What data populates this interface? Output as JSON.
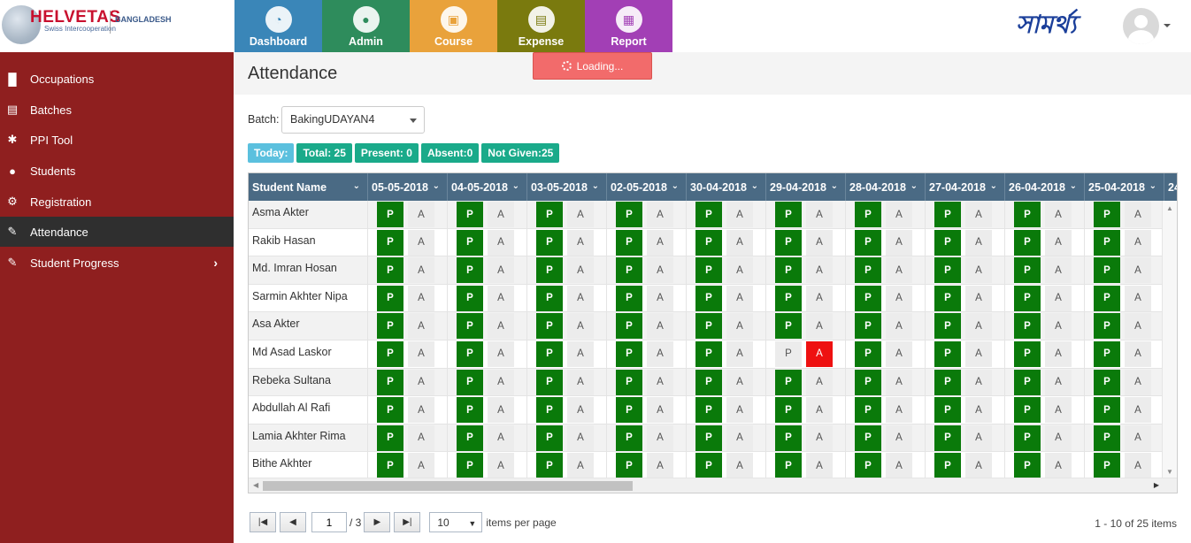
{
  "logo": {
    "brand": "HELVETAS",
    "sub": "Swiss Intercooperation",
    "country": "BANGLADESH"
  },
  "brand_bangla": "সামর্থ্য",
  "menu": [
    {
      "label": "Dashboard",
      "icon": "dashboard-icon",
      "color": "#3a86b8"
    },
    {
      "label": "Admin",
      "icon": "user-icon",
      "color": "#2e8c5c"
    },
    {
      "label": "Course",
      "icon": "book-icon",
      "color": "#e9a23b"
    },
    {
      "label": "Expense",
      "icon": "money-icon",
      "color": "#7a7a0e"
    },
    {
      "label": "Report",
      "icon": "chart-icon",
      "color": "#a23fb5"
    }
  ],
  "loading_text": "Loading...",
  "sidebar": [
    {
      "label": "Occupations",
      "icon": "factory-icon"
    },
    {
      "label": "Batches",
      "icon": "book-icon"
    },
    {
      "label": "PPI Tool",
      "icon": "wrench-icon"
    },
    {
      "label": "Students",
      "icon": "users-icon"
    },
    {
      "label": "Registration",
      "icon": "gears-icon"
    },
    {
      "label": "Attendance",
      "icon": "pencil-icon",
      "active": true
    },
    {
      "label": "Student Progress",
      "icon": "pencil-icon",
      "has_submenu": true
    }
  ],
  "page_title": "Attendance",
  "batch": {
    "label": "Batch:",
    "value": "BakingUDAYAN4"
  },
  "badges": {
    "today": "Today:",
    "total": "Total: 25",
    "present": "Present: 0",
    "absent": "Absent:0",
    "not_given": "Not Given:25"
  },
  "grid": {
    "name_header": "Student Name",
    "dates": [
      "05-05-2018",
      "04-05-2018",
      "03-05-2018",
      "02-05-2018",
      "30-04-2018",
      "29-04-2018",
      "28-04-2018",
      "27-04-2018",
      "26-04-2018",
      "25-04-2018",
      "24"
    ],
    "p_label": "P",
    "a_label": "A",
    "students": [
      "Asma Akter",
      "Rakib Hasan",
      "Md. Imran Hosan",
      "Sarmin Akhter Nipa",
      "Asa Akter",
      "Md Asad Laskor",
      "Rebeka Sultana",
      "Abdullah Al Rafi",
      "Lamia Akhter Rima",
      "Bithe Akhter"
    ],
    "absent_marks": [
      {
        "row": 5,
        "col": 5
      }
    ]
  },
  "pager": {
    "page": "1",
    "of": "/ 3",
    "per_page": "10",
    "per_page_label": "items per page",
    "summary": "1 - 10 of 25 items"
  }
}
